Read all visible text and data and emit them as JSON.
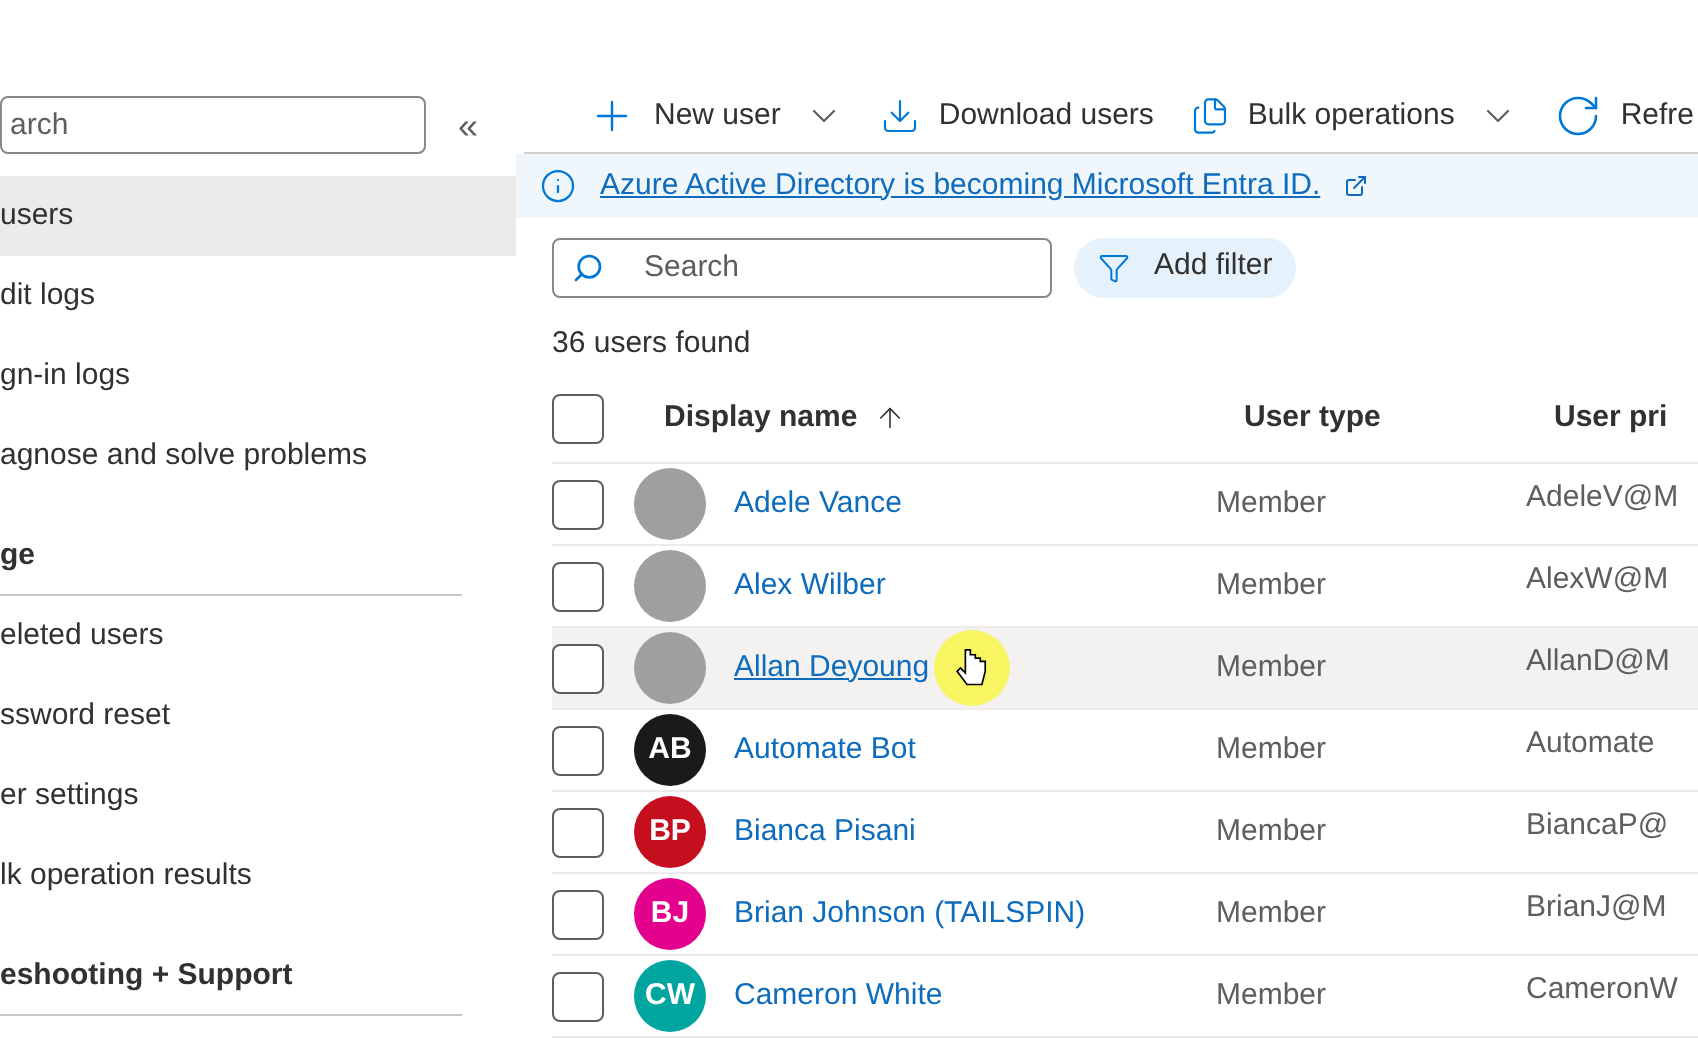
{
  "sidebar": {
    "search": {
      "placeholder": "arch"
    },
    "collapse": "«",
    "items": [
      {
        "kind": "item",
        "label": "users",
        "selected": true
      },
      {
        "kind": "item",
        "label": "dit logs",
        "selected": false
      },
      {
        "kind": "item",
        "label": "gn-in logs",
        "selected": false
      },
      {
        "kind": "item",
        "label": "agnose and solve problems",
        "selected": false
      },
      {
        "kind": "section",
        "label": "ge"
      },
      {
        "kind": "item",
        "label": "eleted users",
        "selected": false
      },
      {
        "kind": "item",
        "label": "ssword reset",
        "selected": false
      },
      {
        "kind": "item",
        "label": "er settings",
        "selected": false
      },
      {
        "kind": "item",
        "label": "lk operation results",
        "selected": false
      },
      {
        "kind": "section",
        "label": "eshooting + Support"
      }
    ]
  },
  "toolbar": [
    {
      "kind": "new",
      "label": "New user",
      "dropdown": true
    },
    {
      "kind": "download",
      "label": "Download users",
      "dropdown": false
    },
    {
      "kind": "bulk",
      "label": "Bulk operations",
      "dropdown": true
    },
    {
      "kind": "refresh",
      "label": "Refre",
      "dropdown": false
    }
  ],
  "banner": {
    "link": "Azure Active Directory is becoming Microsoft Entra ID."
  },
  "search": {
    "placeholder": "Search"
  },
  "filter_button": "Add filter",
  "count": "36 users found",
  "table": {
    "select_all": {
      "checked": false
    },
    "columns": [
      {
        "label": "Display name",
        "sorted": true
      },
      {
        "label": "User type",
        "sorted": false
      },
      {
        "label": "User pri",
        "sorted": false
      }
    ],
    "rows": [
      {
        "avatar": {
          "kind": "photo"
        },
        "name": "Adele Vance",
        "type": "Member",
        "upn": "AdeleV@M",
        "hovered": false,
        "checked": false
      },
      {
        "avatar": {
          "kind": "photo"
        },
        "name": "Alex Wilber",
        "type": "Member",
        "upn": "AlexW@M",
        "hovered": false,
        "checked": false
      },
      {
        "avatar": {
          "kind": "photo"
        },
        "name": "Allan Deyoung",
        "type": "Member",
        "upn": "AllanD@M",
        "hovered": true,
        "checked": false
      },
      {
        "avatar": {
          "kind": "initials",
          "initials": "AB",
          "color": "#1b1a19"
        },
        "name": "Automate Bot",
        "type": "Member",
        "upn": "Automate",
        "hovered": false,
        "checked": false
      },
      {
        "avatar": {
          "kind": "initials",
          "initials": "BP",
          "color": "#c50f1f"
        },
        "name": "Bianca Pisani",
        "type": "Member",
        "upn": "BiancaP@",
        "hovered": false,
        "checked": false
      },
      {
        "avatar": {
          "kind": "initials",
          "initials": "BJ",
          "color": "#e3008c"
        },
        "name": "Brian Johnson (TAILSPIN)",
        "type": "Member",
        "upn": "BrianJ@M",
        "hovered": false,
        "checked": false
      },
      {
        "avatar": {
          "kind": "initials",
          "initials": "CW",
          "color": "#00a5a0"
        },
        "name": "Cameron White",
        "type": "Member",
        "upn": "CameronW",
        "hovered": false,
        "checked": false
      }
    ]
  }
}
